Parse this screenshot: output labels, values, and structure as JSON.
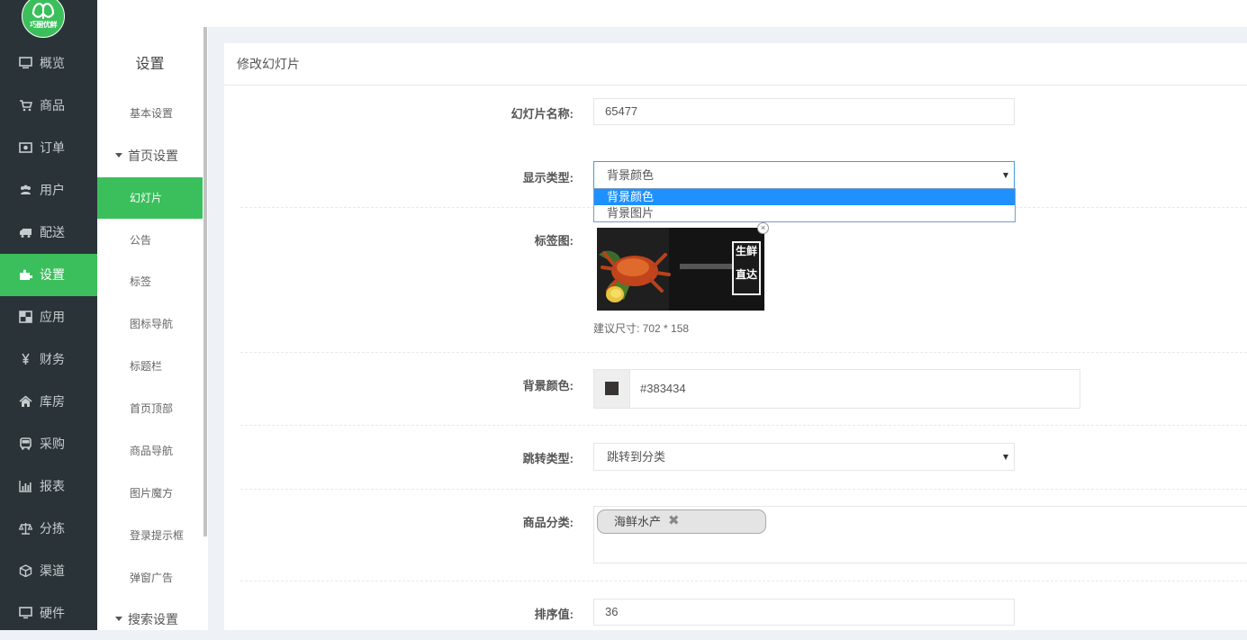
{
  "brand": {
    "logo_text": "巧厨优鲜",
    "accent_color": "#3bbf5c"
  },
  "sidebar": {
    "items": [
      {
        "label": "概览",
        "icon": "monitor-icon"
      },
      {
        "label": "商品",
        "icon": "cart-icon"
      },
      {
        "label": "订单",
        "icon": "money-icon"
      },
      {
        "label": "用户",
        "icon": "users-icon"
      },
      {
        "label": "配送",
        "icon": "truck-icon"
      },
      {
        "label": "设置",
        "icon": "puzzle-icon",
        "active": true
      },
      {
        "label": "应用",
        "icon": "grid-icon"
      },
      {
        "label": "财务",
        "icon": "yen-icon"
      },
      {
        "label": "库房",
        "icon": "home-icon"
      },
      {
        "label": "采购",
        "icon": "bus-icon"
      },
      {
        "label": "报表",
        "icon": "bar-chart-icon"
      },
      {
        "label": "分拣",
        "icon": "scale-icon"
      },
      {
        "label": "渠道",
        "icon": "cube-icon"
      },
      {
        "label": "硬件",
        "icon": "desktop-icon"
      }
    ]
  },
  "submenu": {
    "title": "设置",
    "basic": "基本设置",
    "group_home": "首页设置",
    "items": [
      "幻灯片",
      "公告",
      "标签",
      "图标导航",
      "标题栏",
      "首页顶部",
      "商品导航",
      "图片魔方",
      "登录提示框",
      "弹窗广告"
    ],
    "active_index": 0,
    "group_search": "搜索设置"
  },
  "panel": {
    "title": "修改幻灯片",
    "name_label": "幻灯片名称:",
    "name_value": "65477",
    "display_type_label": "显示类型:",
    "display_type_value": "背景颜色",
    "display_type_options": [
      "背景颜色",
      "背景图片"
    ],
    "tag_image_label": "标签图:",
    "banner_text": {
      "line1": "生鲜",
      "line2": "直达"
    },
    "size_hint": "建议尺寸: 702 * 158",
    "bg_color_label": "背景颜色:",
    "bg_color_value": "#383434",
    "jump_type_label": "跳转类型:",
    "jump_type_value": "跳转到分类",
    "category_label": "商品分类:",
    "category_tag": "海鲜水产",
    "sort_label": "排序值:",
    "sort_value": "36"
  }
}
